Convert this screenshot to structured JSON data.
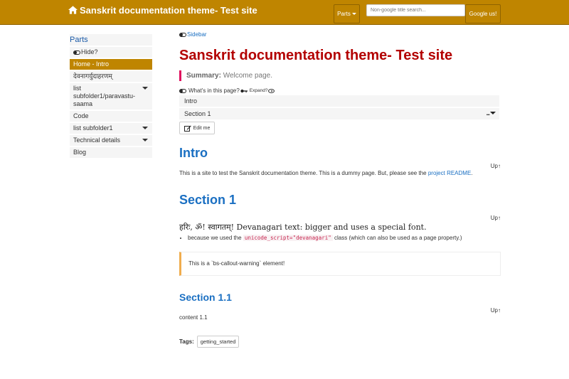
{
  "navbar": {
    "brand": "Sanskrit documentation theme- Test site",
    "parts_label": "Parts",
    "search_placeholder": "Non-google title search...",
    "google_label": "Google us!"
  },
  "sidebar": {
    "title": "Parts",
    "items": [
      {
        "label": "Hide?"
      },
      {
        "label": "Home - Intro"
      },
      {
        "label": "देवनागर्युदाहरणम्"
      },
      {
        "label": "list subfolder1/paravastu-saama"
      },
      {
        "label": "Code"
      },
      {
        "label": "list subfolder1"
      },
      {
        "label": "Technical details"
      },
      {
        "label": "Blog"
      }
    ]
  },
  "main": {
    "sidebar_link": "Sidebar",
    "title": "Sanskrit documentation theme- Test site",
    "summary_label": "Summary:",
    "summary_text": "Welcome page.",
    "toc_label": "What's in this page?",
    "toc_expand": "Expand?",
    "toc_items": [
      "Intro",
      "Section 1"
    ],
    "toc_more": "...",
    "edit_label": "Edit me",
    "intro_heading": "Intro",
    "up_label": "Up↑",
    "intro_text": "This is a site to test the Sanskrit documentation theme. This is a dummy page. But, please see the",
    "intro_link": "project README",
    "intro_end": ".",
    "section1_heading": "Section 1",
    "deva_line": "हरिः, ॐ! स्वागतम्! Devanagari text: bigger and uses a special font.",
    "bullet_pre": "because we used the",
    "bullet_code": "unicode_script=\"devanagari\"",
    "bullet_post": "class (which can also be used as a page property.)",
    "callout_text": "This is a `bs-callout-warning` element!",
    "section11_heading": "Section 1.1",
    "content11": "content 1.1",
    "tags_label": "Tags:",
    "tag": "getting_started"
  },
  "colors": {
    "navbar": "#bf8500",
    "title": "#b30000",
    "heading": "#1a6fc2",
    "summary_bar": "#e0115f",
    "callout_bar": "#f0ad4e"
  }
}
